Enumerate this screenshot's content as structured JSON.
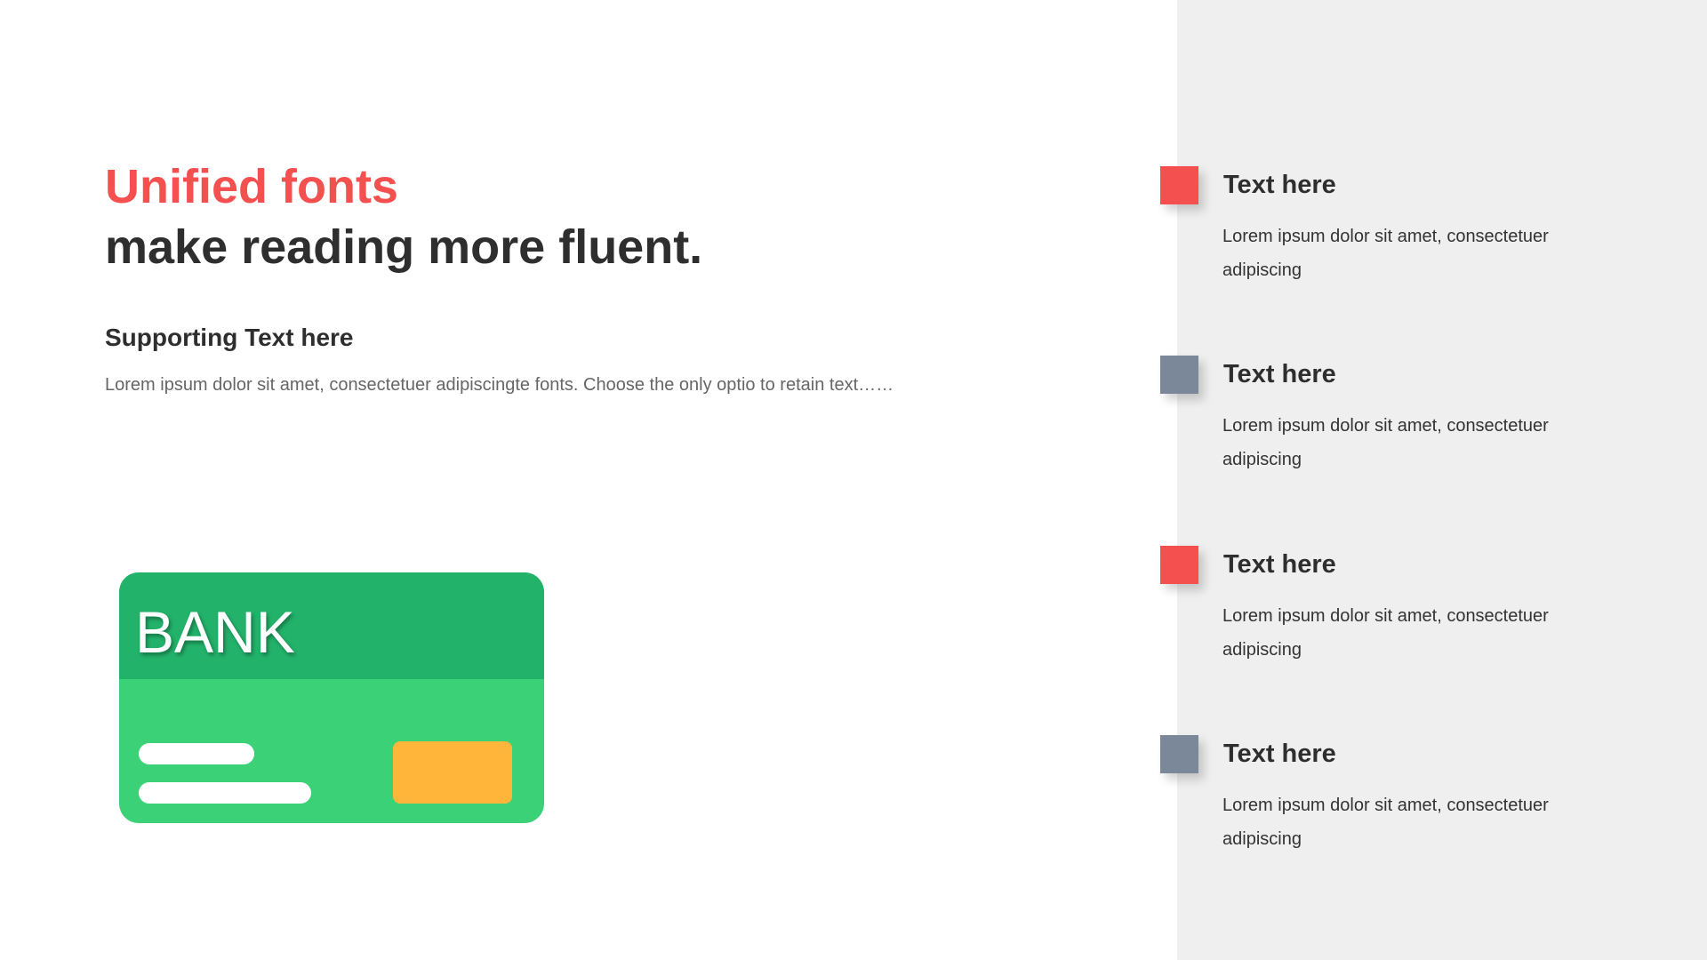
{
  "slide": {
    "title_accent": "Unified fonts",
    "title_main": "make reading more fluent.",
    "supporting_heading": "Supporting Text here",
    "supporting_body": "Lorem ipsum dolor sit amet, consectetuer adipiscingte fonts. Choose the only optio to retain text……"
  },
  "card": {
    "label": "BANK",
    "colors": {
      "top": "#22b26a",
      "bottom": "#3ad177",
      "chip": "#ffb53a"
    }
  },
  "items": [
    {
      "title": "Text here",
      "body": "Lorem ipsum dolor sit amet, consectetuer adipiscing",
      "marker_color": "#f55050"
    },
    {
      "title": "Text here",
      "body": "Lorem ipsum dolor sit amet, consectetuer adipiscing",
      "marker_color": "#7a889a"
    },
    {
      "title": "Text here",
      "body": "Lorem ipsum dolor sit amet, consectetuer adipiscing",
      "marker_color": "#f55050"
    },
    {
      "title": "Text here",
      "body": "Lorem ipsum dolor sit amet, consectetuer adipiscing",
      "marker_color": "#7a889a"
    }
  ],
  "colors": {
    "accent": "#f55050",
    "dark_text": "#2e2e2e",
    "panel_bg": "#efefef"
  }
}
